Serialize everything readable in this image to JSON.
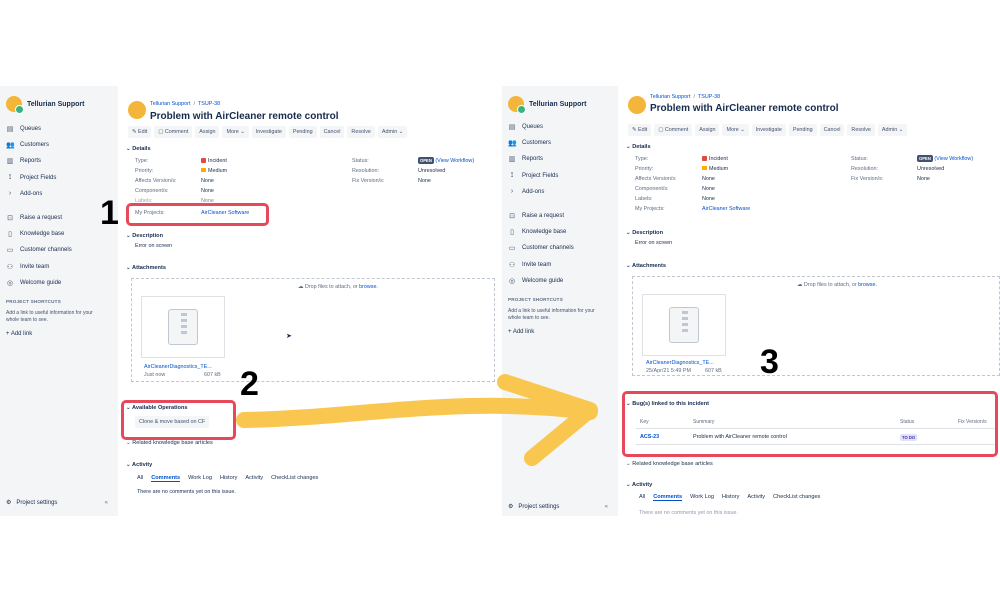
{
  "sidebar": {
    "brand": "Tellurian Support",
    "nav": [
      {
        "icon": "queues-icon",
        "label": "Queues"
      },
      {
        "icon": "customers-icon",
        "label": "Customers"
      },
      {
        "icon": "reports-icon",
        "label": "Reports"
      },
      {
        "icon": "project-fields-icon",
        "label": "Project Fields"
      },
      {
        "icon": "chevron-right-icon",
        "label": "Add-ons"
      }
    ],
    "nav2": [
      {
        "icon": "raise-request-icon",
        "label": "Raise a request"
      },
      {
        "icon": "knowledge-base-icon",
        "label": "Knowledge base"
      },
      {
        "icon": "customer-channels-icon",
        "label": "Customer channels"
      },
      {
        "icon": "invite-team-icon",
        "label": "Invite team"
      },
      {
        "icon": "welcome-guide-icon",
        "label": "Welcome guide"
      }
    ],
    "shortcuts_title": "PROJECT SHORTCUTS",
    "shortcuts_desc": "Add a link to useful information for your whole team to see.",
    "add_link": "Add link",
    "project_settings": "Project settings",
    "collapse": "«"
  },
  "issue": {
    "breadcrumb_project": "Tellurian Support",
    "breadcrumb_sep": "/",
    "breadcrumb_key": "TSUP-38",
    "title": "Problem with AirCleaner remote control",
    "toolbar": [
      "Edit",
      "Comment",
      "Assign",
      "More ⌄",
      "Investigate",
      "Pending",
      "Cancel",
      "Resolve",
      "Admin ⌄"
    ],
    "details_heading": "Details",
    "fields": {
      "type_label": "Type:",
      "type_value": "Incident",
      "priority_label": "Priority:",
      "priority_value": "Medium",
      "affects_label": "Affects Version/s:",
      "affects_value": "None",
      "components_label": "Component/s:",
      "components_value": "None",
      "labels_label": "Labels:",
      "labels_value": "None",
      "projects_label": "My Projects:",
      "projects_value": "AirCleaner Software",
      "status_label": "Status:",
      "status_value": "OPEN",
      "view_workflow": "(View Workflow)",
      "resolution_label": "Resolution:",
      "resolution_value": "Unresolved",
      "fix_label": "Fix Version/s:",
      "fix_value": "None"
    },
    "description_heading": "Description",
    "description": "Error on screen",
    "attachments_heading": "Attachments",
    "drop_text": "Drop files to attach, or",
    "browse": "browse.",
    "left_attachment": {
      "name": "AirCleanerDiagnostics_TE...",
      "date": "Just now",
      "size": "607 kB"
    },
    "right_attachment": {
      "name": "AirCleanerDiagnostics_TE...",
      "date": "25/Apr/21 5:49 PM",
      "size": "607 kB"
    },
    "operations_heading": "Available Operations",
    "operations_button": "Clone & move based on CF",
    "related_heading": "Related knowledge base articles",
    "bugs_heading": "Bug(s) linked to this incident",
    "bugs_columns": [
      "Key",
      "Summary",
      "Status",
      "Fix Version/s"
    ],
    "bug_row": {
      "key": "ACS-23",
      "summary": "Problem with AirCleaner remote control",
      "status": "TO DO"
    },
    "activity_heading": "Activity",
    "activity_tabs": [
      "All",
      "Comments",
      "Work Log",
      "History",
      "Activity",
      "CheckList changes"
    ],
    "no_comments": "There are no comments yet on this issue."
  },
  "annotations": {
    "step1": "1",
    "step2": "2",
    "step3": "3"
  },
  "colors": {
    "highlight": "#e8495a",
    "arrow": "#f9c74f",
    "link": "#0052cc"
  }
}
